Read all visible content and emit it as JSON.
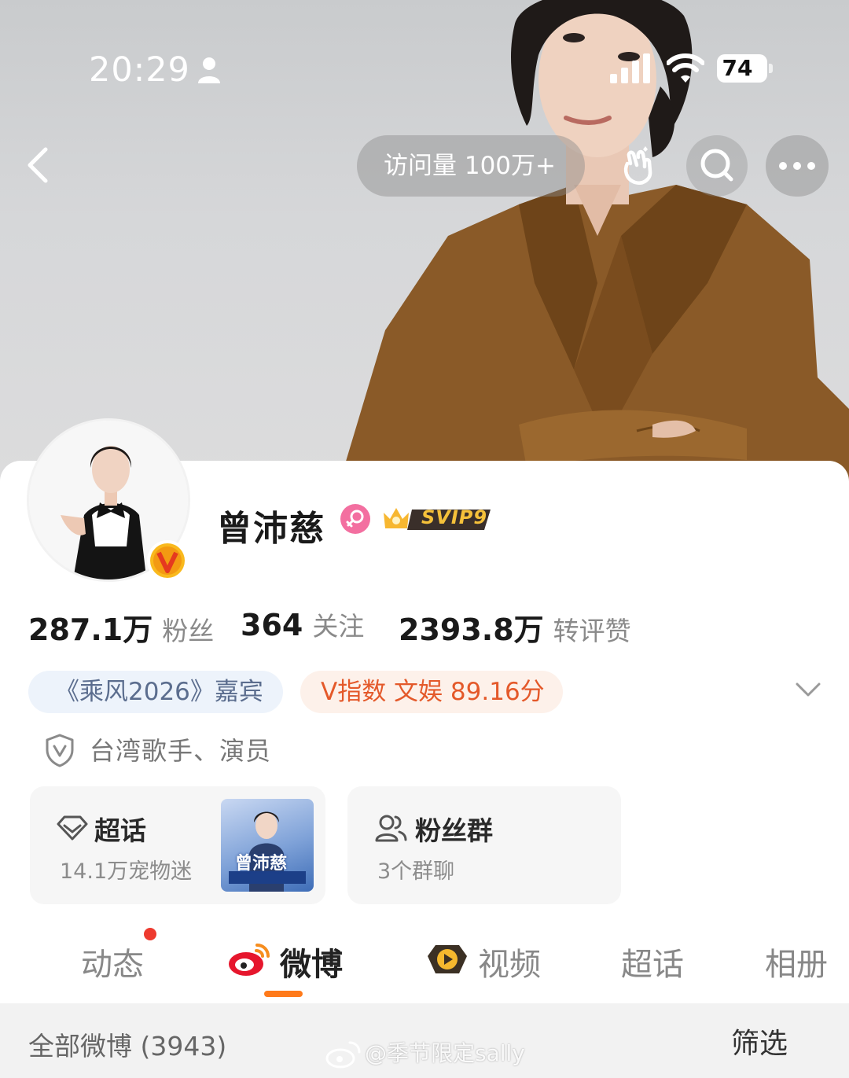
{
  "status_bar": {
    "time": "20:29",
    "battery": "74"
  },
  "header": {
    "visits": "访问量 100万+"
  },
  "profile": {
    "name": "曾沛慈",
    "svip": "SVIP9",
    "stats": [
      {
        "value": "287.1万",
        "label": "粉丝"
      },
      {
        "value": "364",
        "label": "关注"
      },
      {
        "value": "2393.8万",
        "label": "转评赞"
      }
    ],
    "tags": {
      "show": "《乘风2026》嘉宾",
      "vindex": "V指数 文娱 89.16分"
    },
    "verified": "台湾歌手、演员"
  },
  "cards": {
    "topic": {
      "title": "超话",
      "sub": "14.1万宠物迷",
      "thumb_text": "曾沛慈"
    },
    "fans": {
      "title": "粉丝群",
      "sub": "3个群聊"
    }
  },
  "tabs": [
    "动态",
    "微博",
    "视频",
    "超话",
    "相册"
  ],
  "feed": {
    "all": "全部微博 (3943)",
    "filter": "筛选"
  },
  "watermark": "@季节限定sally",
  "colors": {
    "accent": "#ff7a1a",
    "vindex": "#e4592a",
    "dot": "#ee3a2f"
  }
}
